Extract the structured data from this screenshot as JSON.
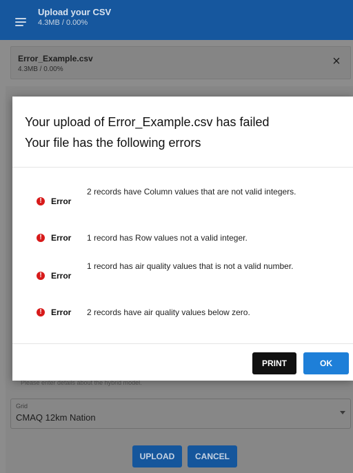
{
  "header": {
    "title": "Upload your CSV",
    "subtitle": "4.3MB / 0.00%"
  },
  "file": {
    "name": "Error_Example.csv",
    "size": "4.3MB / 0.00%",
    "close_label": "×"
  },
  "form": {
    "helper_text": "Please enter details about the hybrid model.",
    "grid_label": "Grid",
    "grid_value": "CMAQ 12km Nation",
    "upload_label": "UPLOAD",
    "cancel_label": "CANCEL"
  },
  "dialog": {
    "title_line1": "Your upload of Error_Example.csv has failed",
    "title_line2": "Your file has the following errors",
    "errors": [
      {
        "label": "Error",
        "message": "2 records have Column values that are not valid integers."
      },
      {
        "label": "Error",
        "message": "1 record has Row values not a valid integer."
      },
      {
        "label": "Error",
        "message": "1 record has air quality values that is not a valid number."
      },
      {
        "label": "Error",
        "message": "2 records have air quality values below zero."
      }
    ],
    "print_label": "PRINT",
    "ok_label": "OK"
  },
  "colors": {
    "header_bg": "#16579e",
    "error_icon": "#d71a1a",
    "ok_button": "#1e7fd8",
    "print_button": "#111111"
  }
}
